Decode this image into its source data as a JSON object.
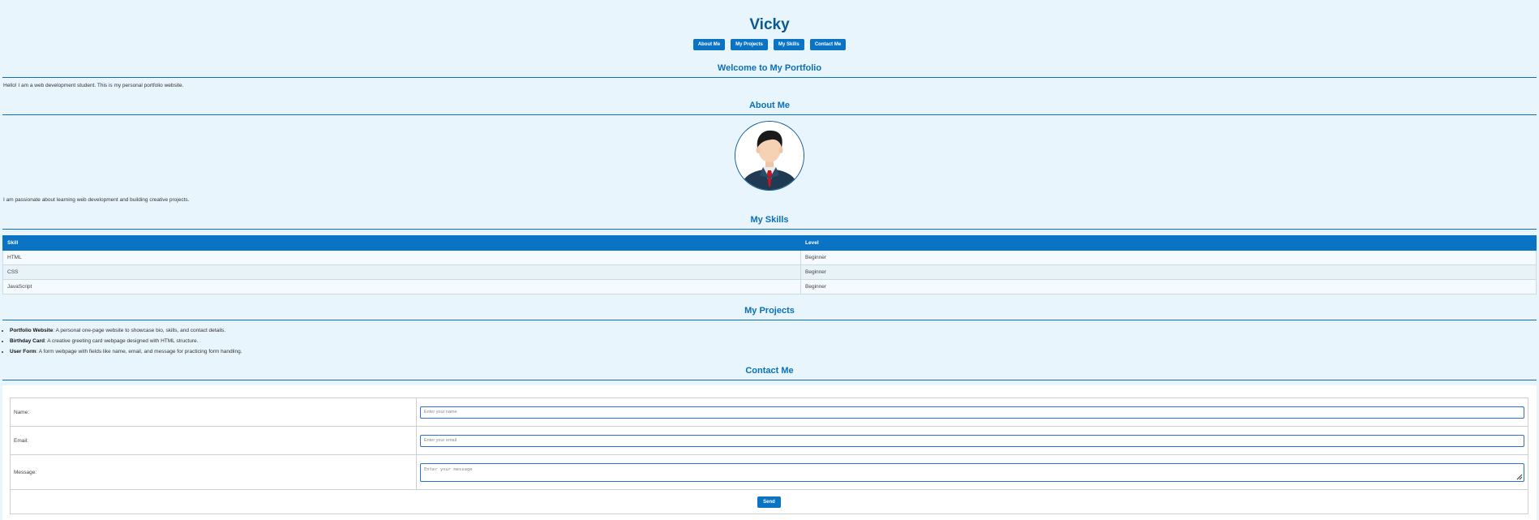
{
  "header": {
    "title": "Vicky",
    "nav": [
      {
        "label": "About Me"
      },
      {
        "label": "My Projects"
      },
      {
        "label": "My Skills"
      },
      {
        "label": "Contact Me"
      }
    ]
  },
  "welcome": {
    "heading": "Welcome to My Portfolio",
    "text": "Hello! I am a web development student. This is my personal portfolio website."
  },
  "about": {
    "heading": "About Me",
    "avatar_icon": "person-in-suit-avatar-icon",
    "text": "I am passionate about learning web development and building creative projects."
  },
  "skills": {
    "heading": "My Skills",
    "columns": [
      "Skill",
      "Level"
    ],
    "rows": [
      [
        "HTML",
        "Beginner"
      ],
      [
        "CSS",
        "Beginner"
      ],
      [
        "JavaScript",
        "Beginner"
      ]
    ]
  },
  "projects": {
    "heading": "My Projects",
    "items": [
      {
        "name": "Portfolio Website",
        "desc": ": A personal one-page website to showcase bio, skills, and contact details."
      },
      {
        "name": "Birthday Card",
        "desc": ": A creative greeting card webpage designed with HTML structure."
      },
      {
        "name": "User Form",
        "desc": ": A form webpage with fields like name, email, and message for practicing form handling."
      }
    ]
  },
  "contact": {
    "heading": "Contact Me",
    "name_label": "Name:",
    "name_placeholder": "Enter your name",
    "email_label": "Email:",
    "email_placeholder": "Enter your email",
    "message_label": "Message:",
    "message_placeholder": "Enter your message",
    "send_label": "Send"
  },
  "colors": {
    "background": "#e9f5fd",
    "accent": "#0a73c4",
    "heading": "#0a6fb8",
    "title": "#0a5a8f"
  }
}
